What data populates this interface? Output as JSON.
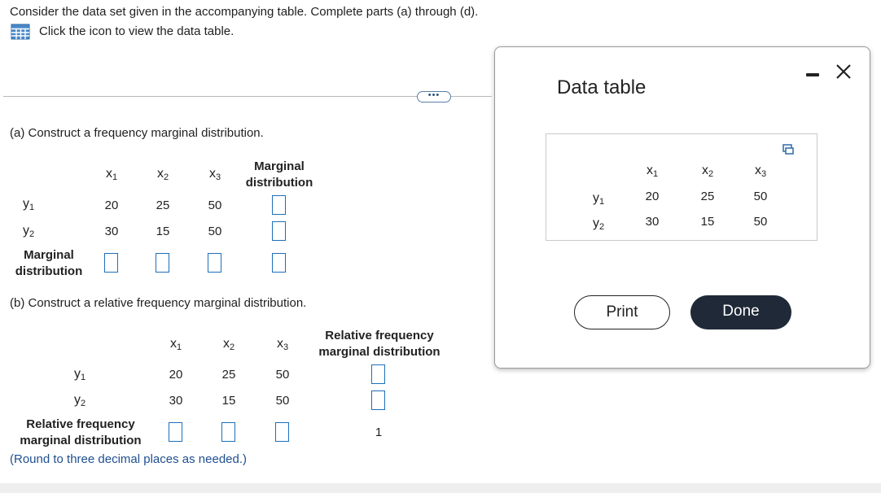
{
  "question": {
    "intro": "Consider the data set given in the accompanying table. Complete parts (a) through (d).",
    "table_link": "Click the icon to view the data table.",
    "more_button": "•••"
  },
  "variables": {
    "x": [
      "x",
      "x",
      "x"
    ],
    "x_subs": [
      "1",
      "2",
      "3"
    ],
    "y": [
      "y",
      "y"
    ],
    "y_subs": [
      "1",
      "2"
    ]
  },
  "data_rows": [
    [
      "20",
      "25",
      "50"
    ],
    [
      "30",
      "15",
      "50"
    ]
  ],
  "part_a": {
    "prompt": "(a) Construct a frequency marginal distribution.",
    "col_header_line1": "Marginal",
    "col_header_line2": "distribution",
    "row_label_line1": "Marginal",
    "row_label_line2": "distribution"
  },
  "part_b": {
    "prompt": "(b) Construct a relative frequency marginal distribution.",
    "col_header_line1": "Relative frequency",
    "col_header_line2": "marginal distribution",
    "row_label_line1": "Relative frequency",
    "row_label_line2": "marginal distribution",
    "total": "1",
    "note": "(Round to three decimal places as needed.)"
  },
  "modal": {
    "title": "Data table",
    "print_label": "Print",
    "done_label": "Done"
  },
  "colors": {
    "input_border": "#1e6fb8",
    "done_bg": "#1f2937",
    "link_blue": "#1f4f8f"
  },
  "icons": [
    "table-icon",
    "copy-icon",
    "minimize-icon",
    "close-icon"
  ]
}
